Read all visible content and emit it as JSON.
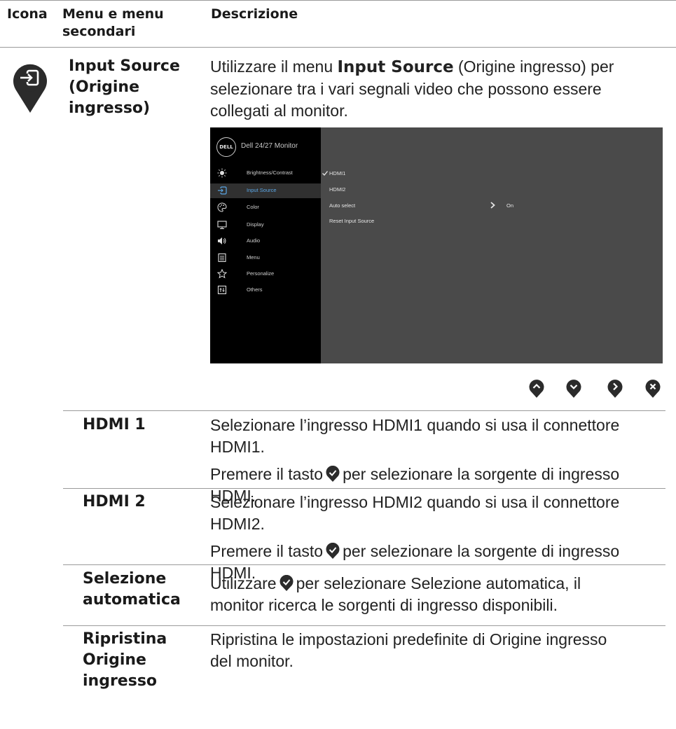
{
  "header": {
    "col_icon": "Icona",
    "col_menu_line1": "Menu e menu",
    "col_menu_line2": "secondari",
    "col_desc": "Descrizione"
  },
  "input_source": {
    "name_line1": "Input Source",
    "name_line2": "(Origine",
    "name_line3": "ingresso)",
    "desc_line1_pre": "Utilizzare il menu ",
    "desc_line1_bold": "Input Source",
    "desc_line1_post": " (Origine ingresso) per",
    "desc_line2": "selezionare tra i vari segnali video che possono essere",
    "desc_line3": "collegati al monitor."
  },
  "osd": {
    "logo": "DELL",
    "title": "Dell 24/27 Monitor",
    "menu": [
      {
        "label": "Brightness/Contrast",
        "icon": "brightness-icon",
        "active": false
      },
      {
        "label": "Input Source",
        "icon": "input-source-icon",
        "active": true
      },
      {
        "label": "Color",
        "icon": "palette-icon",
        "active": false
      },
      {
        "label": "Display",
        "icon": "display-icon",
        "active": false
      },
      {
        "label": "Audio",
        "icon": "speaker-icon",
        "active": false
      },
      {
        "label": "Menu",
        "icon": "menu-list-icon",
        "active": false
      },
      {
        "label": "Personalize",
        "icon": "star-icon",
        "active": false
      },
      {
        "label": "Others",
        "icon": "others-icon",
        "active": false
      }
    ],
    "options": {
      "hdmi1": "HDMI1",
      "hdmi2": "HDMI2",
      "auto_select": "Auto select",
      "auto_select_value": "On",
      "reset": "Reset Input Source"
    },
    "selected_option": "HDMI1"
  },
  "nav_buttons": [
    "up-button-icon",
    "down-button-icon",
    "right-button-icon",
    "close-button-icon"
  ],
  "rows": {
    "hdmi1": {
      "name": "HDMI 1",
      "line1": "Selezionare l’ingresso HDMI1 quando si usa il connettore",
      "line2": "HDMI1.",
      "press_pre": "Premere il tasto",
      "press_post": "per selezionare la sorgente di ingresso",
      "press_line2": "HDMI."
    },
    "hdmi2": {
      "name": "HDMI 2",
      "line1": "Selezionare l’ingresso HDMI2 quando si usa il connettore",
      "line2": "HDMI2.",
      "press_pre": "Premere il tasto",
      "press_post": "per selezionare la sorgente di ingresso",
      "press_line2": "HDMI."
    },
    "auto": {
      "name_line1": "Selezione",
      "name_line2": "automatica",
      "line1_pre": "Utilizzare",
      "line1_post": "per selezionare Selezione automatica, il",
      "line2": "monitor ricerca le sorgenti di ingresso disponibili."
    },
    "reset": {
      "name_line1": "Ripristina",
      "name_line2": "Origine",
      "name_line3": "ingresso",
      "line1": "Ripristina le impostazioni predefinite di Origine ingresso",
      "line2": "del monitor."
    }
  },
  "colors": {
    "osd_background": "#4a4a4a",
    "osd_sidebar": "#000000",
    "osd_active_text": "#5aa7e6",
    "rule": "#9a9a9a",
    "icon_fill": "#2b2b2b"
  }
}
